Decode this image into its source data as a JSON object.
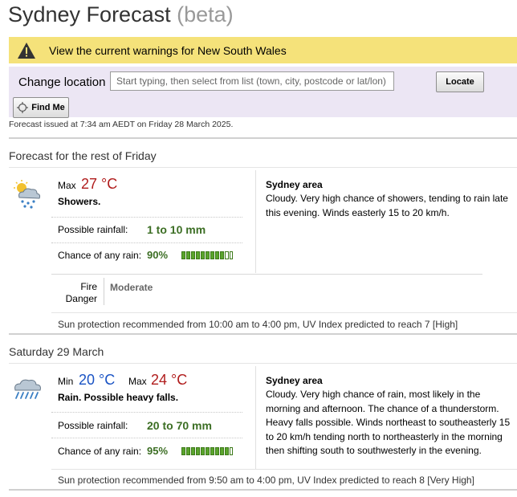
{
  "header": {
    "title": "Sydney Forecast",
    "beta": "(beta)"
  },
  "warning": {
    "text": "View the current warnings for New South Wales",
    "icon": "warning-triangle-icon"
  },
  "location": {
    "label": "Change location",
    "placeholder": "Start typing, then select from list (town, city, postcode or lat/lon)",
    "locate_label": "Locate",
    "find_me_label": "Find Me"
  },
  "issued": "Forecast issued at 7:34 am AEDT on Friday 28 March 2025.",
  "days": [
    {
      "heading": "Forecast for the rest of Friday",
      "icon": "showers-icon",
      "max_label": "Max",
      "max_temp": "27 °C",
      "summary": "Showers.",
      "rainfall_label": "Possible rainfall:",
      "rainfall": "1 to 10 mm",
      "chance_label": "Chance of any rain:",
      "chance": "90%",
      "chance_value": 0.9,
      "area_title": "Sydney area",
      "area_text": "Cloudy. Very high chance of showers, tending to rain late this evening. Winds easterly 15 to 20 km/h.",
      "fire_label": "Fire Danger",
      "fire_value": "Moderate",
      "sun": "Sun protection recommended from 10:00 am to 4:00 pm, UV Index predicted to reach 7 [High]"
    },
    {
      "heading": "Saturday 29 March",
      "icon": "rain-icon",
      "min_label": "Min",
      "min_temp": "20 °C",
      "max_label": "Max",
      "max_temp": "24 °C",
      "summary": "Rain. Possible heavy falls.",
      "rainfall_label": "Possible rainfall:",
      "rainfall": "20 to 70 mm",
      "chance_label": "Chance of any rain:",
      "chance": "95%",
      "chance_value": 0.95,
      "area_title": "Sydney area",
      "area_text": "Cloudy. Very high chance of rain, most likely in the morning and afternoon. The chance of a thunderstorm. Heavy falls possible. Winds northeast to southeasterly 15 to 20 km/h tending north to northeasterly in the morning then shifting south to southwesterly in the evening.",
      "sun": "Sun protection recommended from 9:50 am to 4:00 pm, UV Index predicted to reach 8 [Very High]"
    }
  ]
}
